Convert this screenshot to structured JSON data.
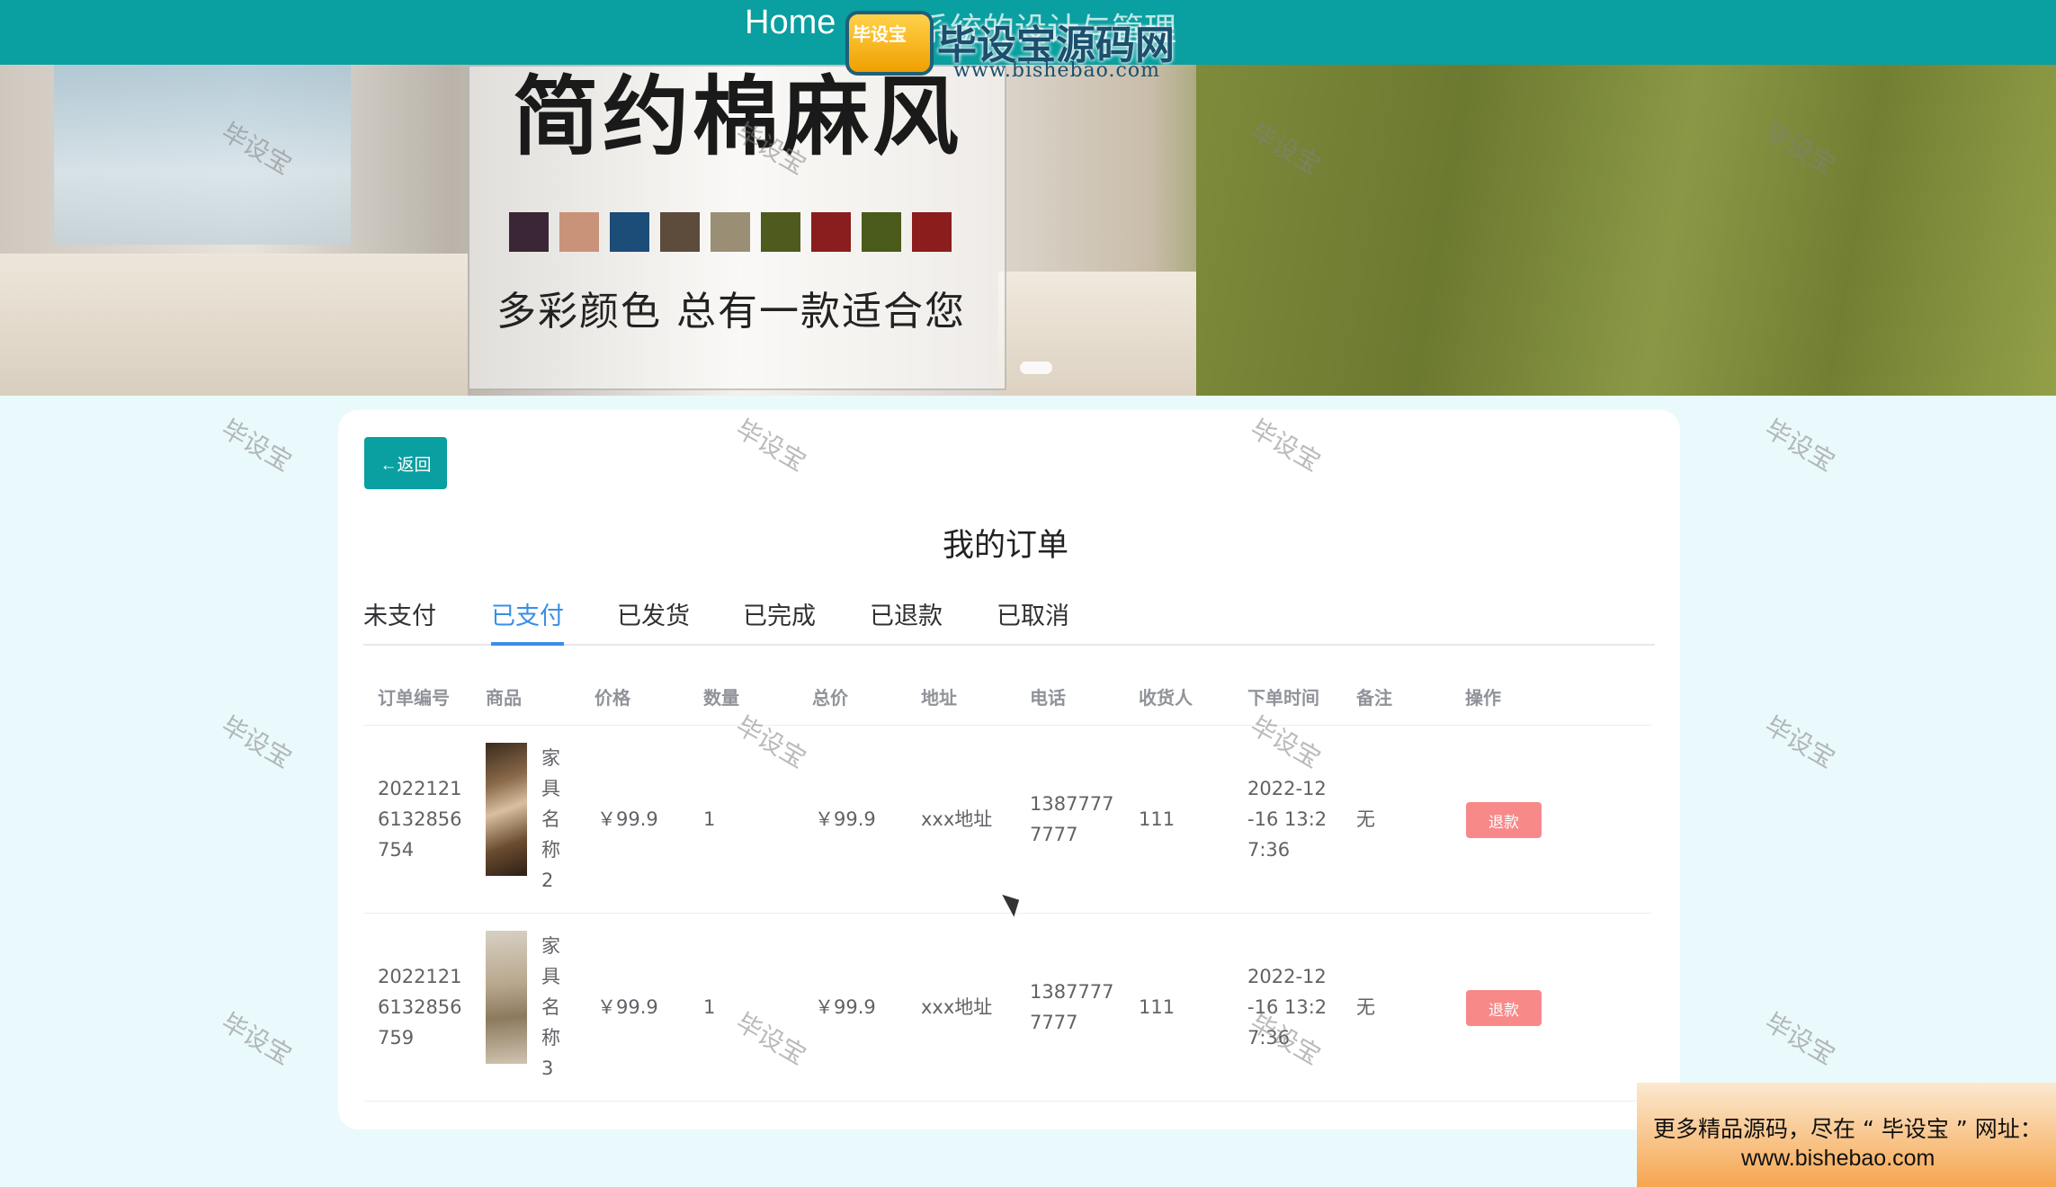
{
  "nav": {
    "home": "Home",
    "system_title": "家居系统的设计与管理"
  },
  "logo_watermark": {
    "badge": "毕设宝",
    "brand": "毕设宝源码网",
    "url": "www.bishebao.com"
  },
  "banner": {
    "headline": "简约棉麻风",
    "slogan": "多彩颜色  总有一款适合您",
    "swatches": [
      "#3b2635",
      "#c9937a",
      "#1c4c78",
      "#5d4c3b",
      "#9a8f74",
      "#4f5a1f",
      "#8a1e1e",
      "#4a5a1b",
      "#8b1d1d"
    ]
  },
  "watermark_text": "毕设宝",
  "back_button": "←返回",
  "page_title": "我的订单",
  "tabs": [
    "未支付",
    "已支付",
    "已发货",
    "已完成",
    "已退款",
    "已取消"
  ],
  "active_tab": "已支付",
  "table": {
    "headers": [
      "订单编号",
      "商品",
      "价格",
      "数量",
      "总价",
      "地址",
      "电话",
      "收货人",
      "下单时间",
      "备注",
      "操作"
    ],
    "rows": [
      {
        "order_no_lines": [
          "2022121",
          "6132856",
          "754"
        ],
        "product_name_chars": [
          "家",
          "具",
          "名",
          "称",
          "2"
        ],
        "price": "￥99.9",
        "qty": "1",
        "total": "￥99.9",
        "address": "xxx地址",
        "phone_lines": [
          "1387777",
          "7777"
        ],
        "receiver": "111",
        "time_lines": [
          "2022-12",
          "-16 13:2",
          "7:36"
        ],
        "remark": "无",
        "action": "退款"
      },
      {
        "order_no_lines": [
          "2022121",
          "6132856",
          "759"
        ],
        "product_name_chars": [
          "家",
          "具",
          "名",
          "称",
          "3"
        ],
        "price": "￥99.9",
        "qty": "1",
        "total": "￥99.9",
        "address": "xxx地址",
        "phone_lines": [
          "1387777",
          "7777"
        ],
        "receiver": "111",
        "time_lines": [
          "2022-12",
          "-16 13:2",
          "7:36"
        ],
        "remark": "无",
        "action": "退款"
      }
    ]
  },
  "promo": {
    "line1": "更多精品源码，尽在 “ 毕设宝 ” 网址：",
    "line2": "www.bishebao.com"
  },
  "colors": {
    "primary": "#0a9fa0",
    "tab_active": "#3a8ee6",
    "danger": "#f78989"
  }
}
